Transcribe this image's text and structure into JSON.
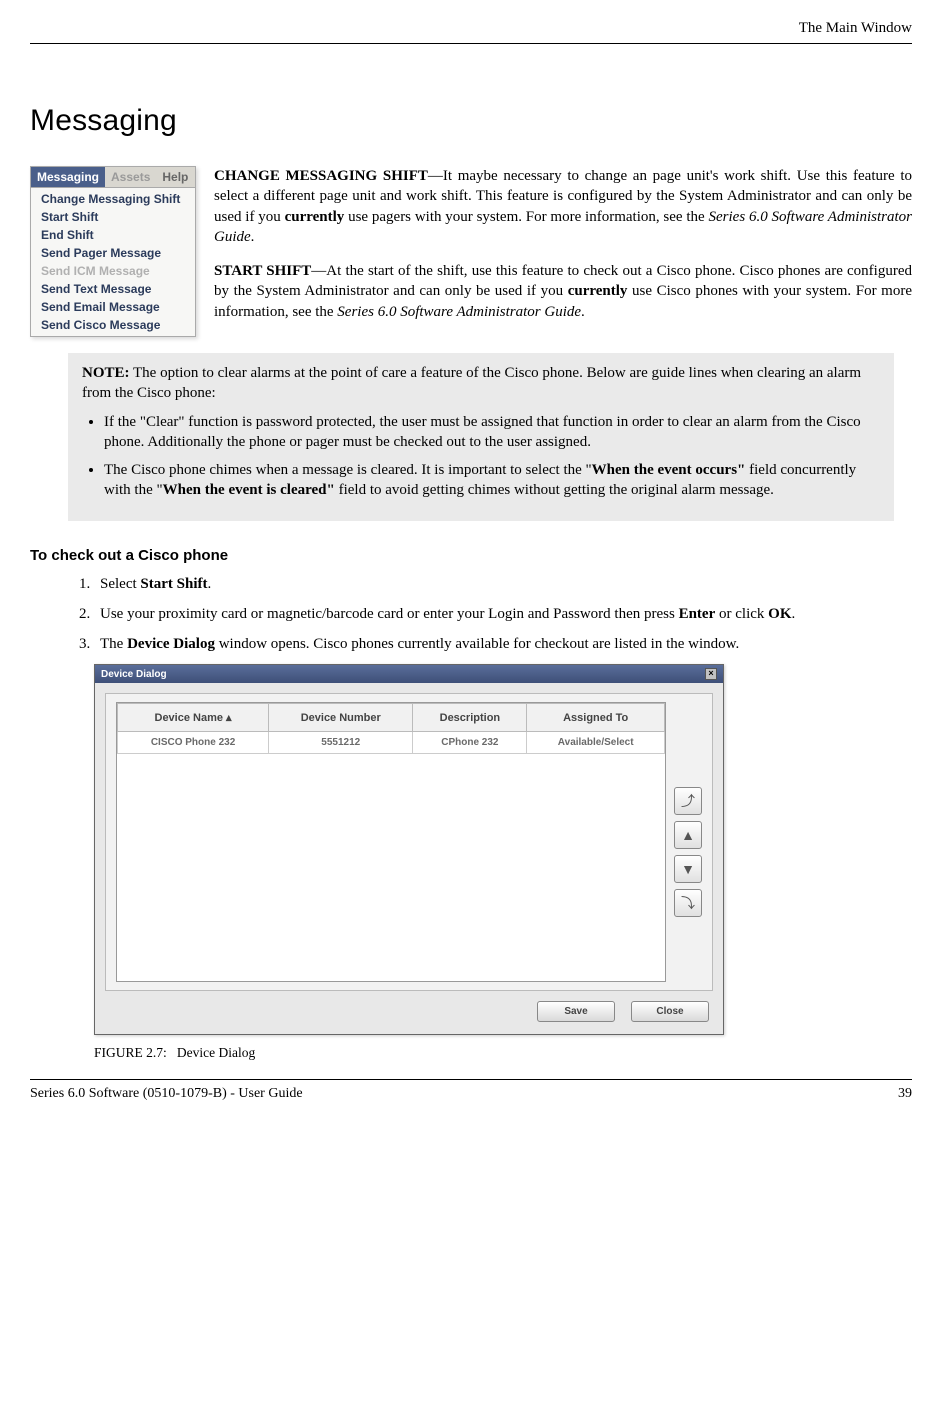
{
  "header": {
    "section_name": "The Main Window"
  },
  "title": "Messaging",
  "menu": {
    "tabs": [
      {
        "label": "Messaging",
        "state": "active"
      },
      {
        "label": "Assets",
        "state": "disabled"
      },
      {
        "label": "Help",
        "state": "normal"
      }
    ],
    "items": [
      {
        "label": "Change Messaging Shift",
        "disabled": false
      },
      {
        "label": "Start Shift",
        "disabled": false
      },
      {
        "label": "End Shift",
        "disabled": false
      },
      {
        "label": "Send Pager Message",
        "disabled": false
      },
      {
        "label": "Send ICM Message",
        "disabled": true
      },
      {
        "label": "Send Text Message",
        "disabled": false
      },
      {
        "label": "Send Email Message",
        "disabled": false
      },
      {
        "label": "Send Cisco Message",
        "disabled": false
      }
    ]
  },
  "para1": {
    "lead": "CHANGE MESSAGING SHIFT",
    "dash": "—",
    "body_a": "It maybe necessary to change an page unit's work shift. Use this feature to select a different page unit and work shift. This feature is configured by the System Administrator and can only be used if you ",
    "bold_inline": "currently",
    "body_b": " use pagers with your system. For more information, see the ",
    "ital": "Series 6.0 Software Administrator Guide",
    "body_c": "."
  },
  "para2": {
    "lead": "START SHIFT",
    "dash": "—",
    "body_a": "At the start of the shift, use this feature to check out a Cisco phone. Cisco phones are configured by the System Administrator and can only be used if you ",
    "bold_inline": "currently",
    "body_b": " use Cisco phones with your system. For more information, see the ",
    "ital": "Series 6.0 Software Administrator Guide",
    "body_c": "."
  },
  "note": {
    "label": "NOTE:",
    "intro": " The option to clear alarms at the point of care a feature of the Cisco phone. Below are guide lines when clearing an alarm from the Cisco phone:",
    "bullets": [
      "If the \"Clear\" function is password protected, the user must be assigned that function in order to clear an alarm from the Cisco phone. Additionally the phone or pager must be checked out to the user assigned.",
      {
        "pre": "The Cisco phone chimes when a message is cleared. It is important to select the \"",
        "b1": "When the event occurs\"",
        "mid": " field concurrently with the \"",
        "b2": "When the event is cleared\"",
        "post": " field to avoid getting chimes without getting the original alarm message."
      }
    ]
  },
  "howto": {
    "heading": "To check out a Cisco phone",
    "steps": [
      {
        "pre": "Select ",
        "b": "Start Shift",
        "post": "."
      },
      {
        "pre": "Use your proximity card or magnetic/barcode card or enter your Login and Password then press ",
        "b": "Enter",
        "mid": " or click ",
        "b2": "OK",
        "post": "."
      },
      {
        "pre": "The ",
        "b": "Device Dialog",
        "post": " window opens. Cisco phones currently available for checkout are listed in the window."
      }
    ]
  },
  "dialog": {
    "title": "Device Dialog",
    "close_glyph": "×",
    "columns": [
      "Device Name ▴",
      "Device Number",
      "Description",
      "Assigned To"
    ],
    "rows": [
      [
        "CISCO Phone 232",
        "5551212",
        "CPhone 232",
        "Available/Select"
      ]
    ],
    "arrows": [
      "⤴",
      "▲",
      "▼",
      "⤵"
    ],
    "buttons": {
      "save": "Save",
      "close": "Close"
    }
  },
  "figure": {
    "label": "FIGURE 2.7:",
    "caption": "Device Dialog"
  },
  "footer": {
    "left": "Series 6.0 Software (0510-1079-B) - User Guide",
    "right": "39"
  }
}
